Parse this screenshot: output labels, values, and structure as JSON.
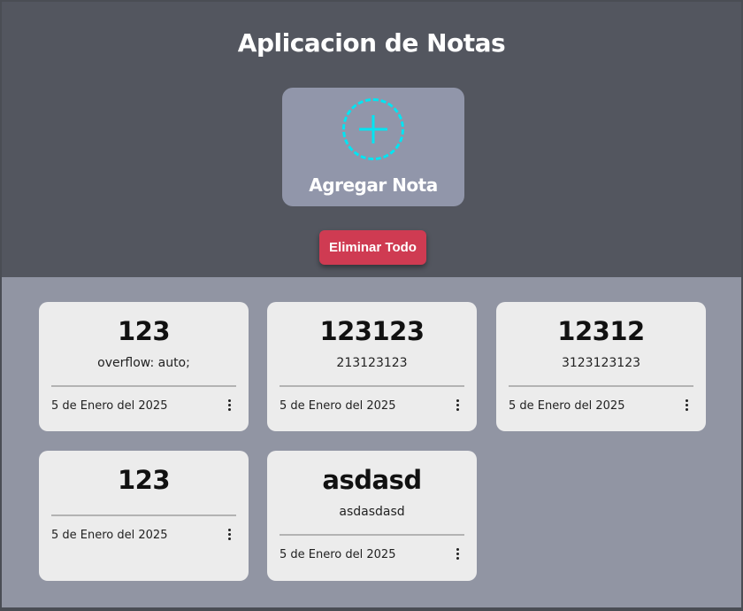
{
  "header": {
    "title": "Aplicacion de Notas",
    "add_label": "Agregar Nota",
    "delete_all_label": "Eliminar Todo"
  },
  "colors": {
    "header_bg": "#53565f",
    "notes_bg": "#9195a3",
    "add_card_bg": "#9196aa",
    "add_icon": "#00e5f2",
    "delete_button": "#cf3b52",
    "note_bg": "#ececec"
  },
  "notes": [
    {
      "title": "123",
      "body": "overflow: auto;",
      "date": "5 de Enero del 2025"
    },
    {
      "title": "123123",
      "body": "213123123",
      "date": "5 de Enero del 2025"
    },
    {
      "title": "12312",
      "body": "3123123123",
      "date": "5 de Enero del 2025"
    },
    {
      "title": "123",
      "body": "",
      "date": "5 de Enero del 2025"
    },
    {
      "title": "asdasd",
      "body": "asdasdasd",
      "date": "5 de Enero del 2025"
    }
  ]
}
